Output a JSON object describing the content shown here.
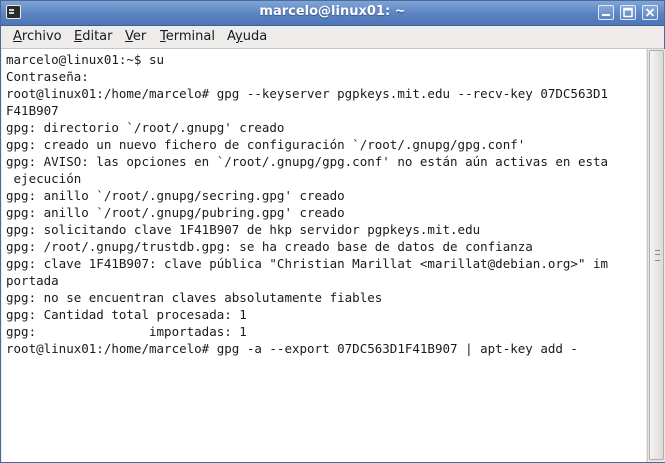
{
  "window": {
    "title": "marcelo@linux01: ~",
    "icon": "terminal-icon",
    "buttons": {
      "minimize": "minimize-icon",
      "maximize": "maximize-icon",
      "close": "close-icon"
    }
  },
  "menu": {
    "items": [
      {
        "accel": "A",
        "rest": "rchivo"
      },
      {
        "accel": "E",
        "rest": "ditar"
      },
      {
        "accel": "V",
        "rest": "er"
      },
      {
        "accel": "T",
        "rest": "erminal"
      },
      {
        "accel": "A",
        "rest": "yuda",
        "prefix": "Ay"
      }
    ]
  },
  "terminal": {
    "lines": [
      "marcelo@linux01:~$ su",
      "Contraseña:",
      "root@linux01:/home/marcelo# gpg --keyserver pgpkeys.mit.edu --recv-key 07DC563D1",
      "F41B907",
      "gpg: directorio `/root/.gnupg' creado",
      "gpg: creado un nuevo fichero de configuración `/root/.gnupg/gpg.conf'",
      "gpg: AVISO: las opciones en `/root/.gnupg/gpg.conf' no están aún activas en esta",
      " ejecución",
      "gpg: anillo `/root/.gnupg/secring.gpg' creado",
      "gpg: anillo `/root/.gnupg/pubring.gpg' creado",
      "gpg: solicitando clave 1F41B907 de hkp servidor pgpkeys.mit.edu",
      "gpg: /root/.gnupg/trustdb.gpg: se ha creado base de datos de confianza",
      "gpg: clave 1F41B907: clave pública \"Christian Marillat <marillat@debian.org>\" im",
      "portada",
      "gpg: no se encuentran claves absolutamente fiables",
      "gpg: Cantidad total procesada: 1",
      "gpg:               importadas: 1",
      "root@linux01:/home/marcelo# gpg -a --export 07DC563D1F41B907 | apt-key add -"
    ]
  },
  "scrollbar": {
    "grip": "grip-icon"
  },
  "pointer": "mouse-pointer-icon"
}
